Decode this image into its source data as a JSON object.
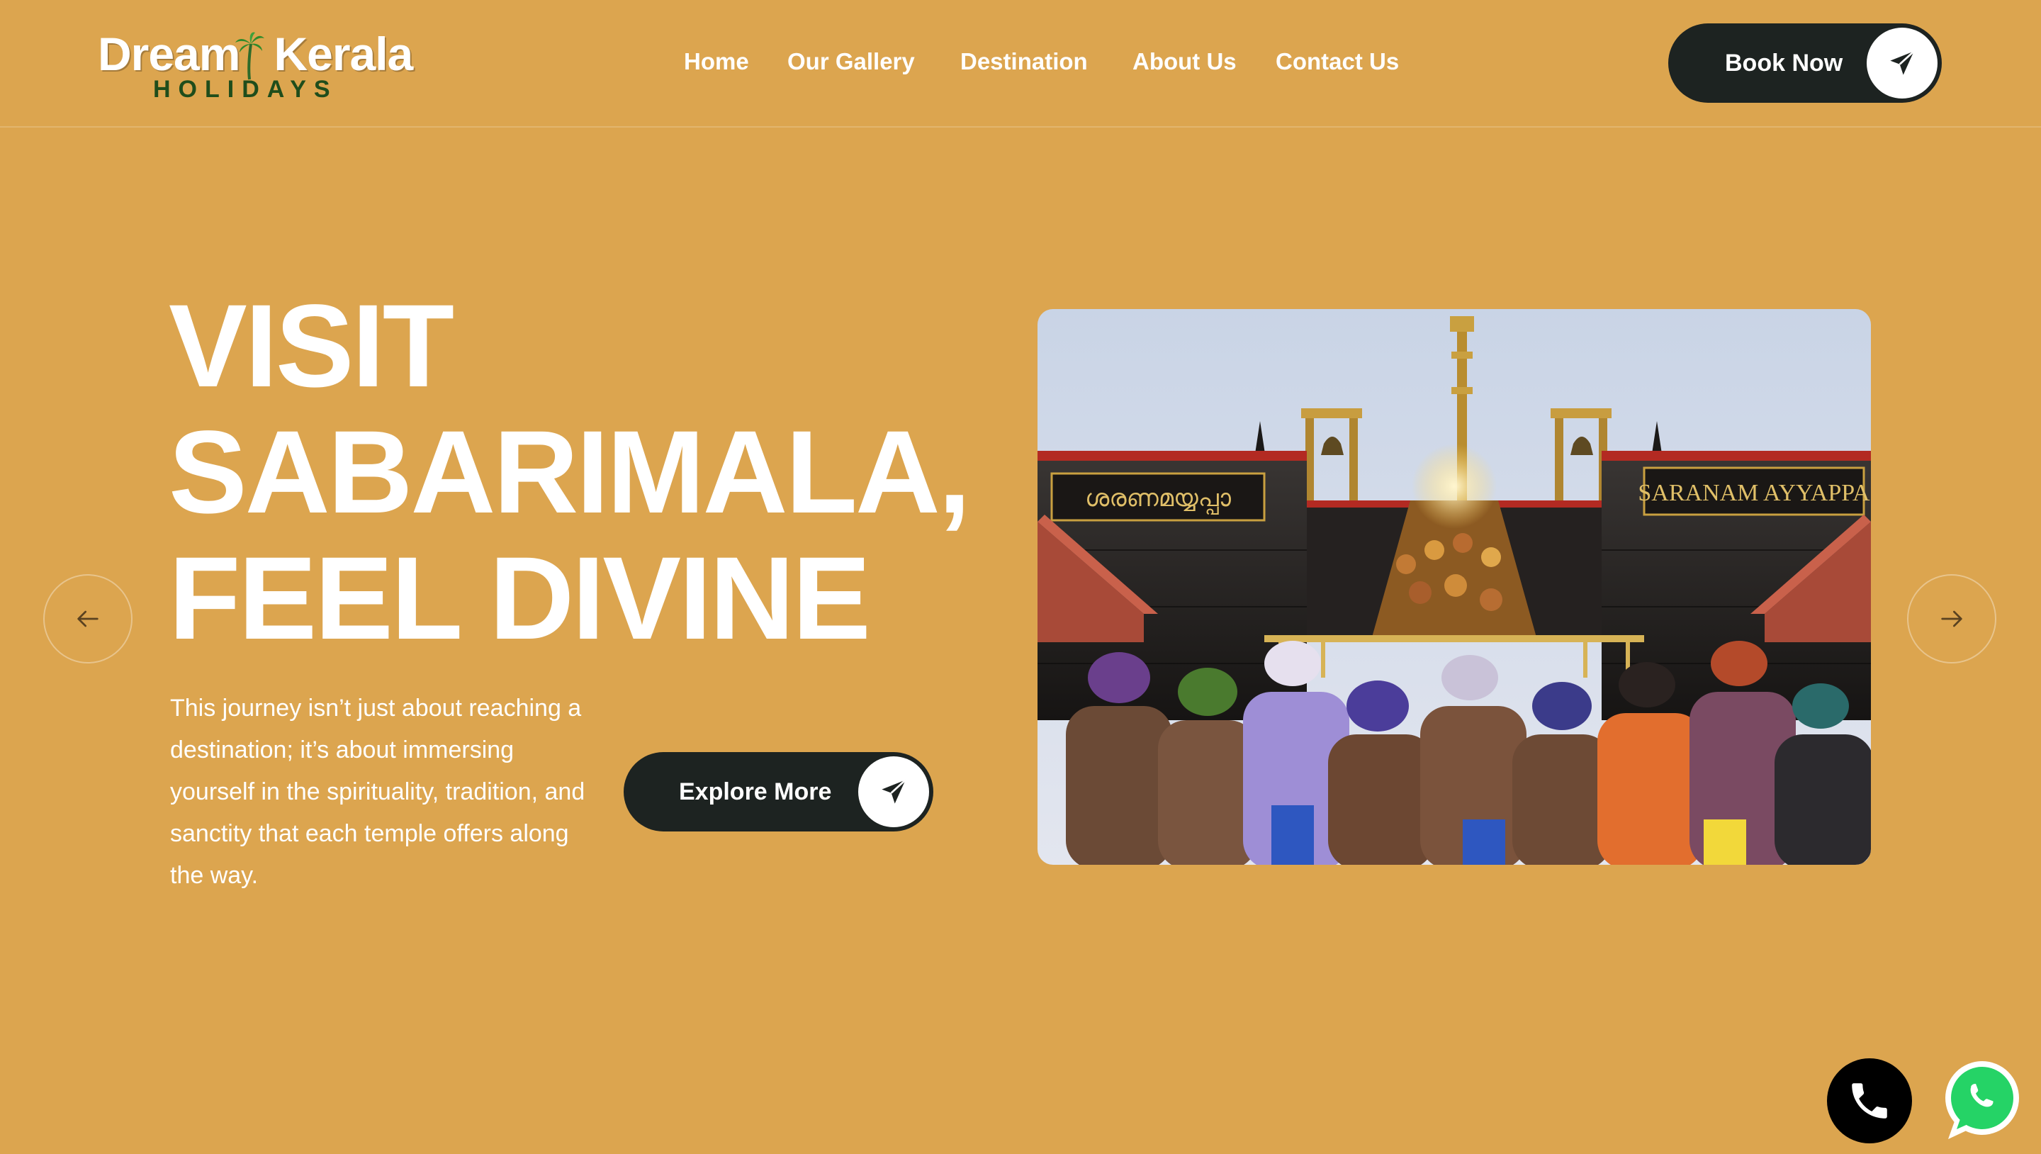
{
  "brand": {
    "logo_word1": "Dream",
    "logo_word2": "Kerala",
    "logo_sub": "HOLIDAYS",
    "logo_sub_color": "#1f4d1b"
  },
  "nav": {
    "items": [
      {
        "label": "Home"
      },
      {
        "label": "Our Gallery"
      },
      {
        "label": "Destination"
      },
      {
        "label": "About Us"
      },
      {
        "label": "Contact Us"
      }
    ]
  },
  "header": {
    "book_label": "Book Now",
    "book_icon": "paper-plane-icon"
  },
  "hero": {
    "title_lines": [
      "VISIT",
      "SABARIMALA,",
      "FEEL DIVINE"
    ],
    "description": "This journey isn’t just about reaching a destination; it’s about immersing yourself in the spirituality, tradition, and sanctity that each temple offers along the way.",
    "cta_label": "Explore More",
    "cta_icon": "paper-plane-icon",
    "image_alt": "Pilgrims climbing the steps of Sabarimala temple",
    "image_sign_left": "ശരണമയ്യപ്പാ",
    "image_sign_right": "SARANAM AYYAPPA"
  },
  "carousel": {
    "prev_icon": "arrow-left-icon",
    "next_icon": "arrow-right-icon"
  },
  "floating": {
    "call_icon": "phone-icon",
    "whatsapp_icon": "whatsapp-icon",
    "whatsapp_color": "#25d366"
  },
  "theme": {
    "background": "#dca54f",
    "button_dark": "#1d2321",
    "text": "#ffffff"
  }
}
